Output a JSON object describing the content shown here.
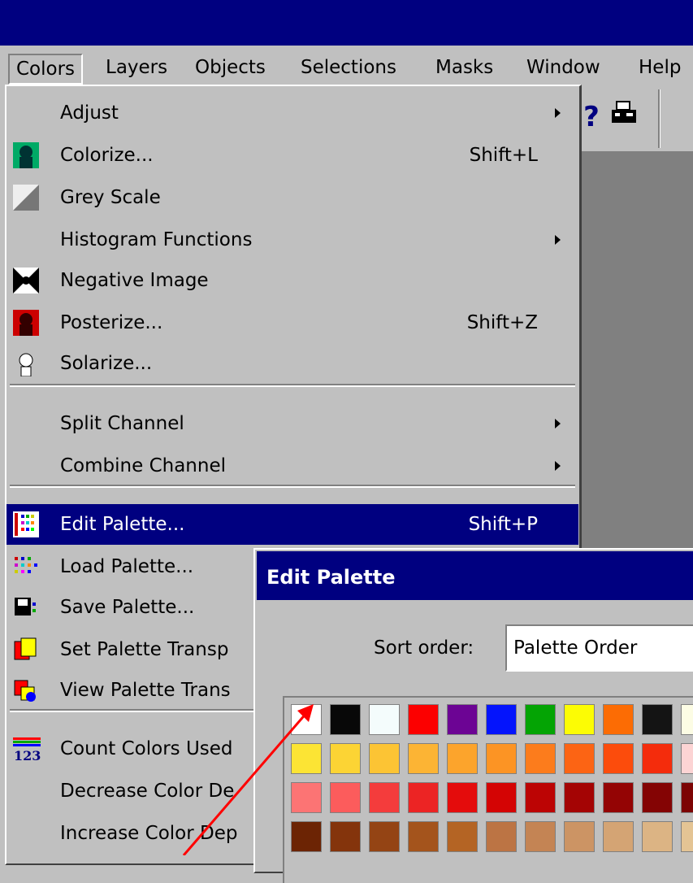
{
  "menubar": {
    "items": [
      "Colors",
      "Layers",
      "Objects",
      "Selections",
      "Masks",
      "Window",
      "Help"
    ]
  },
  "colors_menu": {
    "items": [
      {
        "label": "Adjust",
        "shortcut": "",
        "submenu": true,
        "icon": ""
      },
      {
        "label": "Colorize...",
        "shortcut": "Shift+L",
        "submenu": false,
        "icon": "colorize-icon"
      },
      {
        "label": "Grey Scale",
        "shortcut": "",
        "submenu": false,
        "icon": "grey-scale-icon"
      },
      {
        "label": "Histogram Functions",
        "shortcut": "",
        "submenu": true,
        "icon": ""
      },
      {
        "label": "Negative Image",
        "shortcut": "",
        "submenu": false,
        "icon": "negative-image-icon"
      },
      {
        "label": "Posterize...",
        "shortcut": "Shift+Z",
        "submenu": false,
        "icon": "posterize-icon"
      },
      {
        "label": "Solarize...",
        "shortcut": "",
        "submenu": false,
        "icon": "solarize-icon"
      },
      {
        "label": "Split Channel",
        "shortcut": "",
        "submenu": true,
        "icon": ""
      },
      {
        "label": "Combine Channel",
        "shortcut": "",
        "submenu": true,
        "icon": ""
      },
      {
        "label": "Edit Palette...",
        "shortcut": "Shift+P",
        "submenu": false,
        "icon": "edit-palette-icon",
        "highlighted": true
      },
      {
        "label": "Load Palette...",
        "shortcut": "",
        "submenu": false,
        "icon": "load-palette-icon"
      },
      {
        "label": "Save Palette...",
        "shortcut": "",
        "submenu": false,
        "icon": "save-palette-icon"
      },
      {
        "label": "Set Palette Transp",
        "shortcut": "",
        "submenu": false,
        "icon": "set-transparency-icon"
      },
      {
        "label": "View Palette Trans",
        "shortcut": "",
        "submenu": false,
        "icon": "view-transparency-icon"
      },
      {
        "label": "Count Colors Used",
        "shortcut": "",
        "submenu": false,
        "icon": "count-colors-icon"
      },
      {
        "label": "Decrease Color De",
        "shortcut": "",
        "submenu": false,
        "icon": ""
      },
      {
        "label": "Increase Color Dep",
        "shortcut": "",
        "submenu": false,
        "icon": ""
      }
    ]
  },
  "toolbar": {
    "help_glyph": "?",
    "icons": [
      "help-icon",
      "printer-icon"
    ]
  },
  "dialog": {
    "title": "Edit Palette",
    "sort_label": "Sort order:",
    "sort_value": "Palette Order",
    "swatch_rows": [
      [
        "#ffffff",
        "#080808",
        "#f4fcfc",
        "#fc0000",
        "#6c0494",
        "#0414fc",
        "#04a404",
        "#fcfc04",
        "#fc6c04",
        "#141414",
        "#fcfce4"
      ],
      [
        "#fce434",
        "#fcd434",
        "#fcc434",
        "#fcb434",
        "#fca42c",
        "#fc9424",
        "#fc7c1c",
        "#fc6414",
        "#fc4c0c",
        "#f42c0c",
        "#fcd4d4"
      ],
      [
        "#fc7474",
        "#fc5c5c",
        "#f43c3c",
        "#ec2424",
        "#e40c0c",
        "#d40404",
        "#bc0404",
        "#a40404",
        "#940404",
        "#840404",
        "#7c0404"
      ],
      [
        "#6c2404",
        "#84340c",
        "#944414",
        "#a4541c",
        "#b46424",
        "#bc7444",
        "#c48454",
        "#cc9464",
        "#d4a474",
        "#dcb484",
        "#e4c494"
      ]
    ]
  },
  "colors": {
    "menu_bg": "#c0c0c0",
    "highlight": "#000080",
    "title_bar": "#000080",
    "workspace": "#808080",
    "arrow": "#ff0000"
  }
}
